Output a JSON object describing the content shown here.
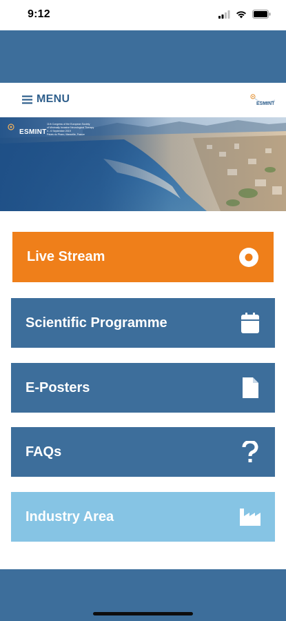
{
  "status_bar": {
    "time": "9:12",
    "icons": [
      "signal-icon",
      "wifi-icon",
      "battery-icon"
    ]
  },
  "navbar": {
    "menu_label": "MENU",
    "menu_icon": "hamburger-icon",
    "logo_text": "ESMINT"
  },
  "banner": {
    "logo_text": "ESMINT",
    "caption_line1": "11th Congress of the European Society",
    "caption_line2": "of Minimally Invasive Neurological Therapy",
    "caption_line3": "4 - 6 September 2019",
    "caption_line4": "Palais du Pharo, Marseille, France"
  },
  "tiles": [
    {
      "label": "Live Stream",
      "icon": "record-circle-icon",
      "color": "#ef7f1a"
    },
    {
      "label": "Scientific Programme",
      "icon": "calendar-icon",
      "color": "#3d6e9b"
    },
    {
      "label": "E-Posters",
      "icon": "document-icon",
      "color": "#3d6e9b"
    },
    {
      "label": "FAQs",
      "icon": "question-mark-icon",
      "color": "#3d6e9b"
    },
    {
      "label": "Industry Area",
      "icon": "factory-icon",
      "color": "#86c4e4"
    }
  ],
  "colors": {
    "primary_blue": "#3d6e9b",
    "accent_orange": "#ef7f1a",
    "light_blue": "#86c4e4"
  }
}
